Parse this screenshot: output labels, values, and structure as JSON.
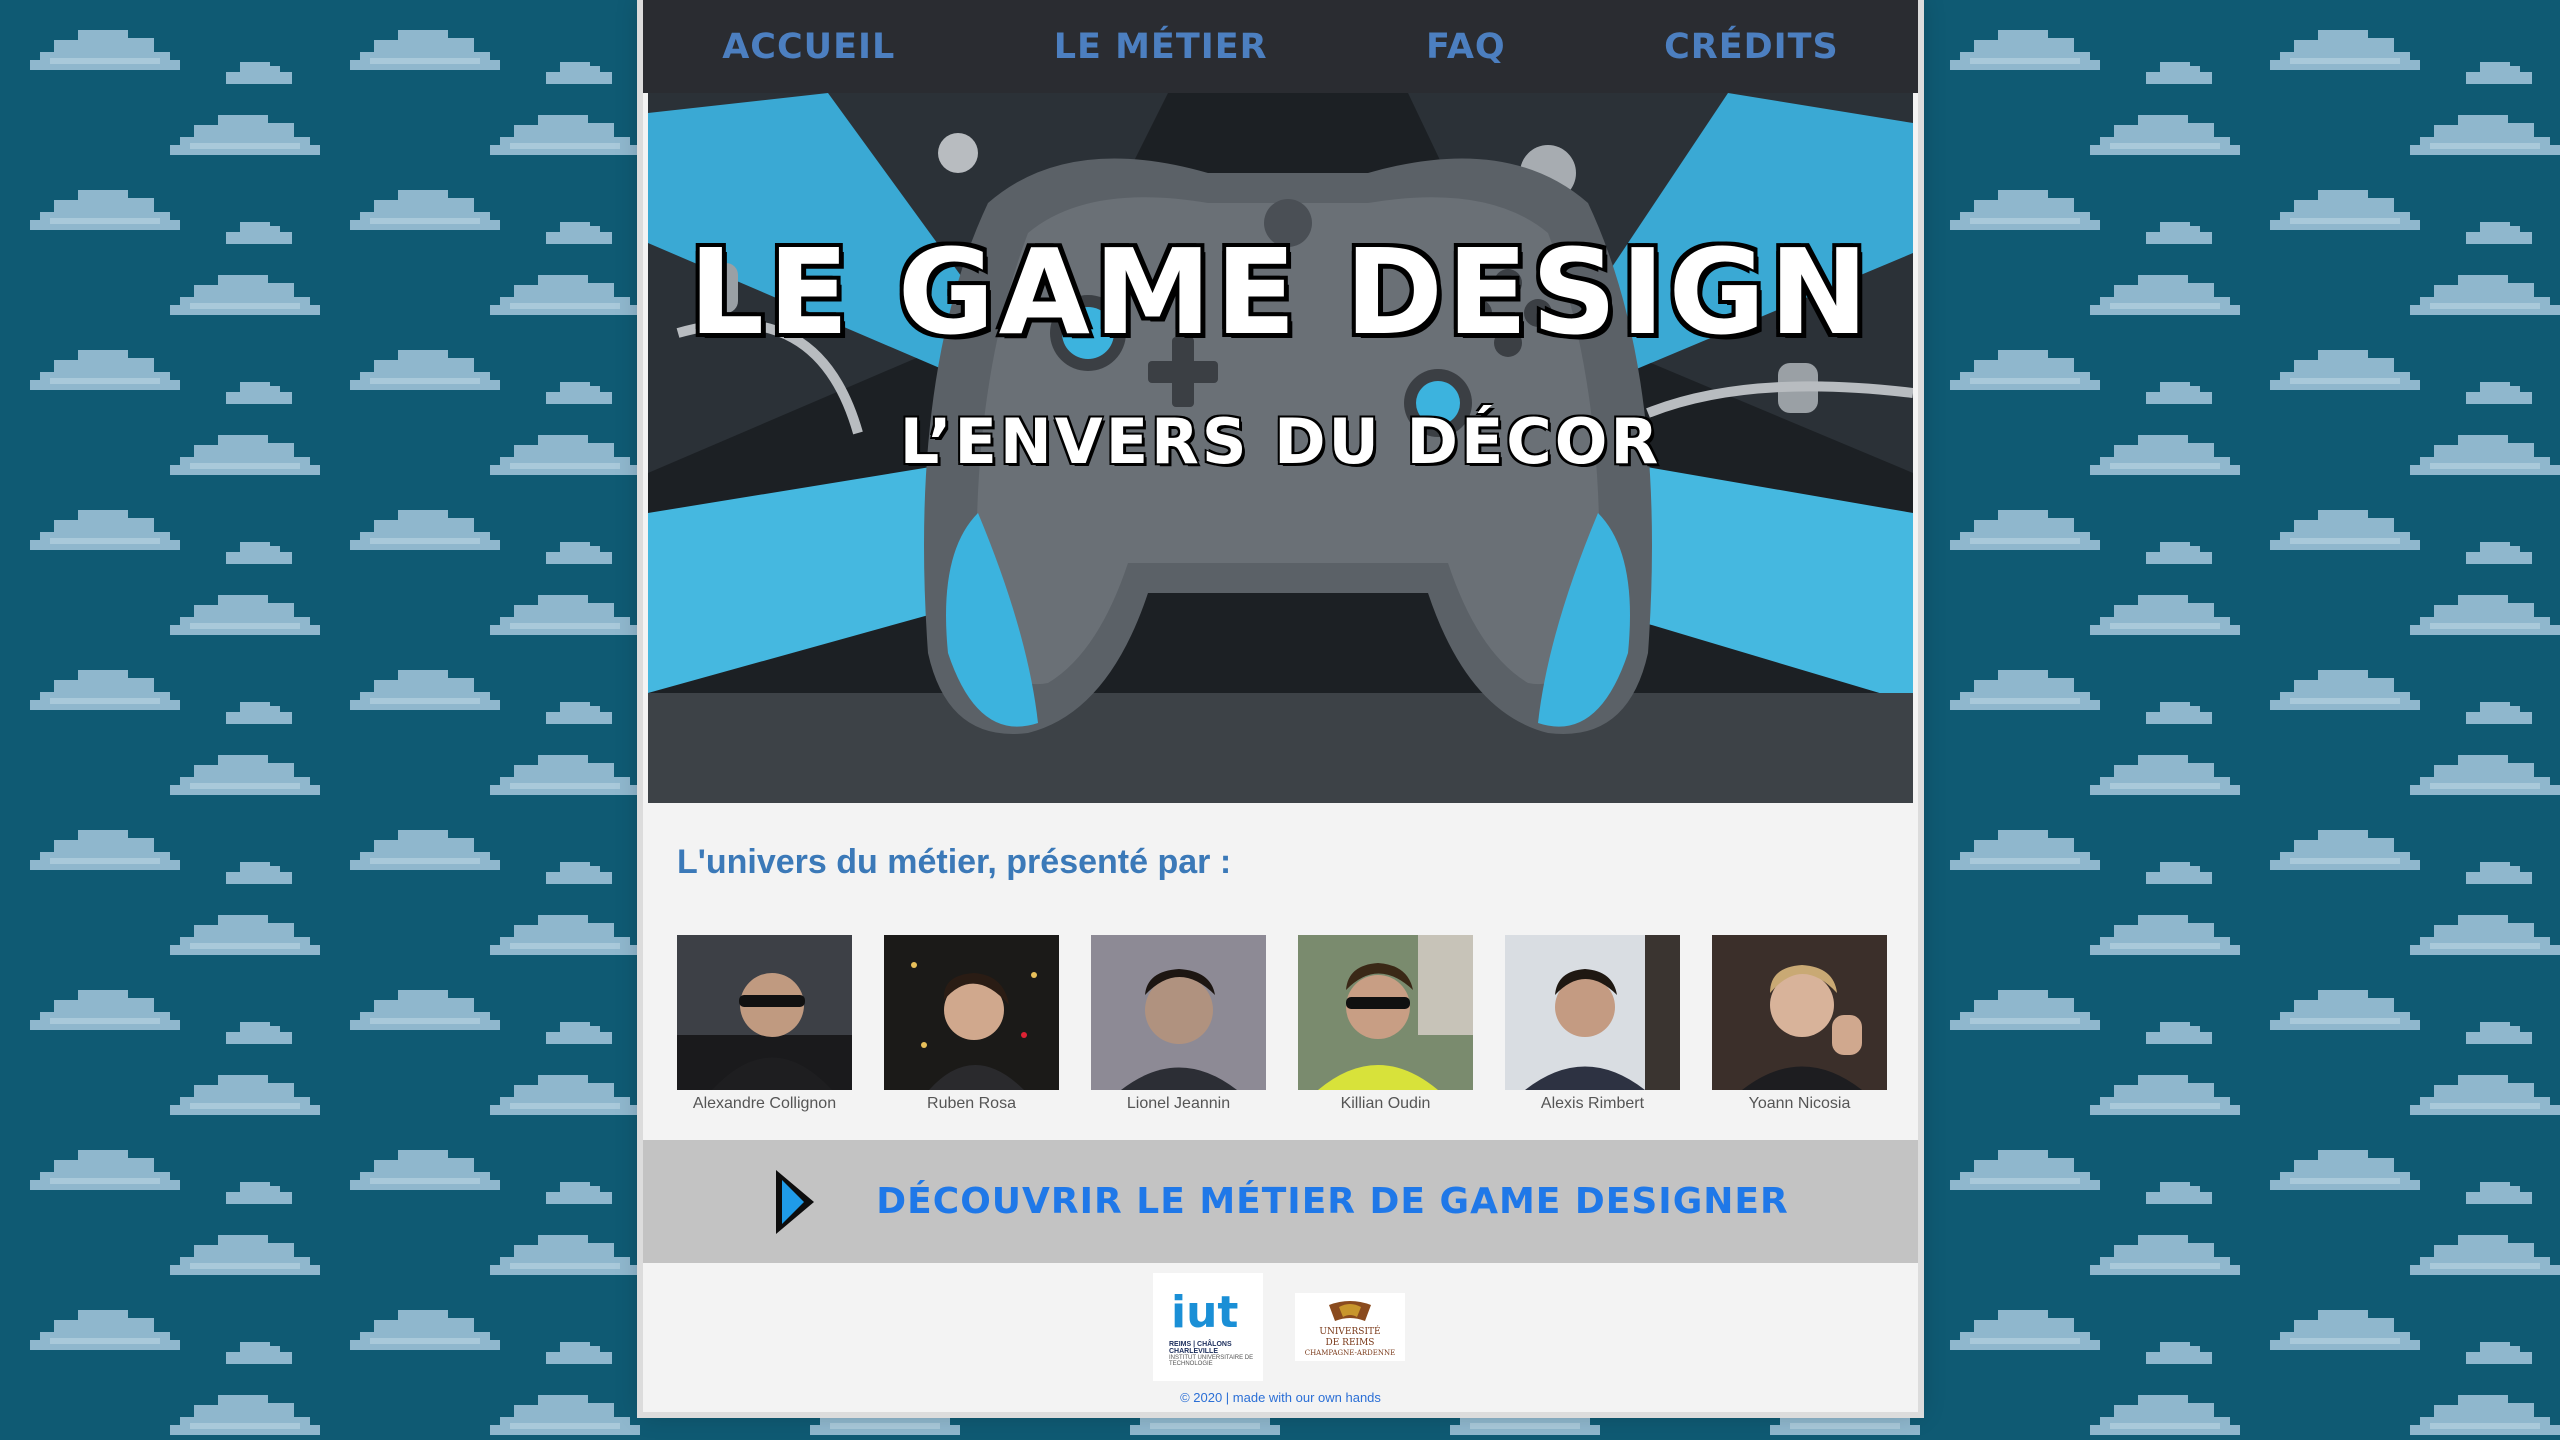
{
  "nav": {
    "items": [
      {
        "label": "Accueil"
      },
      {
        "label": "Le métier"
      },
      {
        "label": "FAQ"
      },
      {
        "label": "Crédits"
      }
    ]
  },
  "hero": {
    "title": "Le game design",
    "subtitle": "L’envers du décor"
  },
  "presenters": {
    "heading": "L'univers du métier, présenté par :",
    "members": [
      {
        "name": "Alexandre Collignon"
      },
      {
        "name": "Ruben Rosa"
      },
      {
        "name": "Lionel Jeannin"
      },
      {
        "name": "Killian Oudin"
      },
      {
        "name": "Alexis Rimbert"
      },
      {
        "name": "Yoann Nicosia"
      }
    ]
  },
  "cta": {
    "label": "Découvrir le métier de game designer"
  },
  "logos": {
    "iut": {
      "main": "iut",
      "sub1": "REIMS | CHÂLONS CHARLEVILLE",
      "sub2": "INSTITUT UNIVERSITAIRE DE TECHNOLOGIE"
    },
    "univ": {
      "line1": "UNIVERSITÉ",
      "line2": "DE REIMS",
      "line3": "CHAMPAGNE-ARDENNE"
    }
  },
  "footer": {
    "text": "© 2020 | made with our own hands"
  },
  "colors": {
    "background": "#0f5a73",
    "cloud": "#8fb7cd",
    "nav": "#2a2c31",
    "nav_link": "#4c7fc0",
    "accent": "#1f78e8",
    "heading": "#3b79b8"
  }
}
